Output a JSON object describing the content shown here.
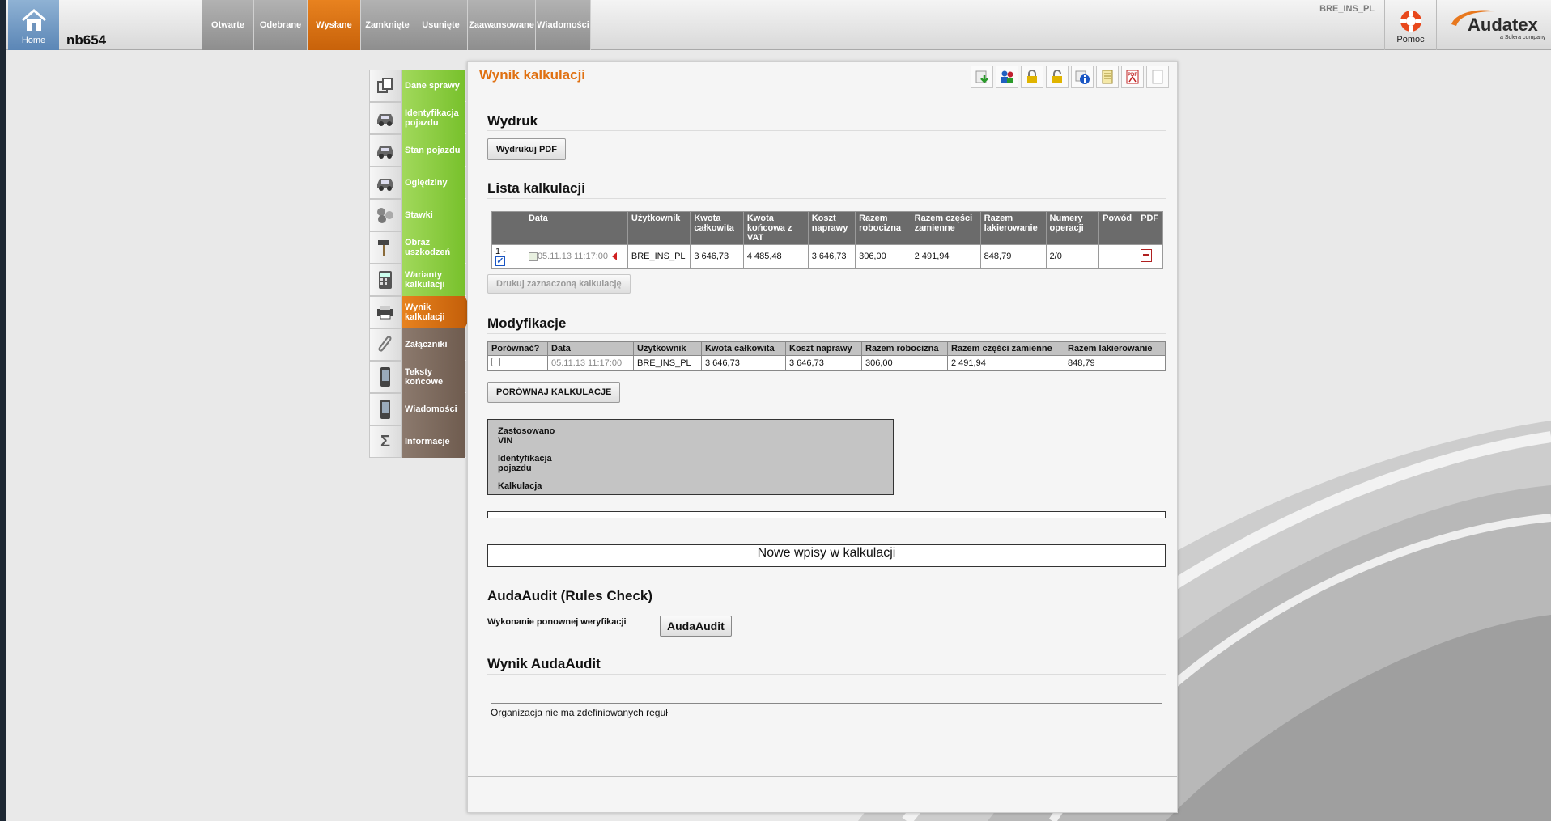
{
  "header": {
    "home_label": "Home",
    "case_id": "nb654",
    "tabs": [
      "Otwarte",
      "Odebrane",
      "Wysłane",
      "Zamknięte",
      "Usunięte",
      "Zaawansowane",
      "Wiadomości"
    ],
    "active_tab": "Wysłane",
    "user": "BRE_INS_PL",
    "help_label": "Pomoc",
    "logo_text": "Audatex",
    "logo_sub": "a Solera company"
  },
  "sidebar": {
    "items": [
      {
        "label": "Dane sprawy",
        "icon": "copy-icon"
      },
      {
        "label": "Identyfikacja pojazdu",
        "icon": "car-icon"
      },
      {
        "label": "Stan pojazdu",
        "icon": "car-icon"
      },
      {
        "label": "Oględziny",
        "icon": "car-inspect-icon"
      },
      {
        "label": "Stawki",
        "icon": "coins-icon"
      },
      {
        "label": "Obraz uszkodzeń",
        "icon": "hammer-icon"
      },
      {
        "label": "Warianty kalkulacji",
        "icon": "calculator-icon"
      },
      {
        "label": "Wynik kalkulacji",
        "icon": "printer-icon"
      },
      {
        "label": "Załączniki",
        "icon": "paperclip-icon"
      },
      {
        "label": "Teksty końcowe",
        "icon": "phone-icon"
      },
      {
        "label": "Wiadomości",
        "icon": "phone-icon"
      },
      {
        "label": "Informacje",
        "icon": "sigma-icon"
      }
    ]
  },
  "main": {
    "title": "Wynik kalkulacji",
    "print_section": "Wydruk",
    "print_pdf_button": "Wydrukuj PDF",
    "list_section": "Lista kalkulacji",
    "calc_headers": [
      "",
      "",
      "Data",
      "Użytkownik",
      "Kwota całkowita",
      "Kwota końcowa z VAT",
      "Koszt naprawy",
      "Razem robocizna",
      "Razem części zamienne",
      "Razem lakierowanie",
      "Numery operacji",
      "Powód",
      "PDF"
    ],
    "calc_row": {
      "index": "1 -",
      "date": "05.11.13 11:17:00",
      "user": "BRE_INS_PL",
      "total": "3 646,73",
      "final_vat": "4 485,48",
      "repair": "3 646,73",
      "labour": "306,00",
      "parts": "2 491,94",
      "paint": "848,79",
      "ops": "2/0",
      "reason": ""
    },
    "print_selected_button": "Drukuj zaznaczoną kalkulację",
    "mod_section": "Modyfikacje",
    "mod_headers": [
      "Porównać?",
      "Data",
      "Użytkownik",
      "Kwota całkowita",
      "Koszt naprawy",
      "Razem robocizna",
      "Razem części zamienne",
      "Razem lakierowanie"
    ],
    "mod_row": {
      "date": "05.11.13 11:17:00",
      "user": "BRE_INS_PL",
      "total": "3 646,73",
      "repair": "3 646,73",
      "labour": "306,00",
      "parts": "2 491,94",
      "paint": "848,79"
    },
    "compare_button": "PORÓWNAJ KALKULACJE",
    "info": {
      "line1": "Zastosowano",
      "line1b": "VIN",
      "line2": "Identyfikacja",
      "line2b": "pojazdu",
      "line3": "Kalkulacja"
    },
    "new_entries": "Nowe wpisy w kalkulacji",
    "audit_section": "AudaAudit (Rules Check)",
    "reverify_label": "Wykonanie ponownej weryfikacji",
    "audit_button": "AudaAudit",
    "result_section": "Wynik AudaAudit",
    "no_rules": "Organizacja nie ma zdefiniowanych reguł"
  },
  "colors": {
    "accent": "#e07010",
    "active_tab": "#d86e14",
    "nav_green": "#80c535",
    "nav_brown": "#7a6759"
  }
}
